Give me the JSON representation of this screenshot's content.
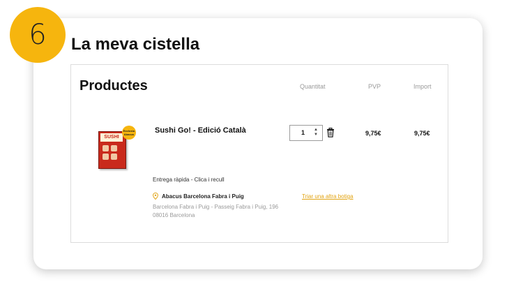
{
  "step": "6",
  "page_title": "La meva cistella",
  "section_title": "Productes",
  "columns": {
    "quantity": "Quantitat",
    "pvp": "PVP",
    "import": "Import"
  },
  "product": {
    "name": "Sushi Go! - Edició Català",
    "image_logo_text": "SUSHI GO!",
    "badge_text": "Exclusiu Abacus",
    "quantity": "1",
    "pvp": "9,75€",
    "import": "9,75€"
  },
  "delivery": {
    "text": "Entrega ràpida - Clica i recull",
    "store_name": "Abacus Barcelona Fabra i Puig",
    "change_store_label": "Triar una altra botiga",
    "address_line1": "Barcelona Fabra i Puig - Passeig Fabra i Puig, 196",
    "address_line2": "08016 Barcelona"
  },
  "colors": {
    "accent": "#f6b50e",
    "link": "#e2a413",
    "box_red": "#c92a1c"
  },
  "icons": {
    "trash": "trash-icon",
    "location": "location-pin-icon",
    "spinner": "stepper-arrows-icon"
  }
}
